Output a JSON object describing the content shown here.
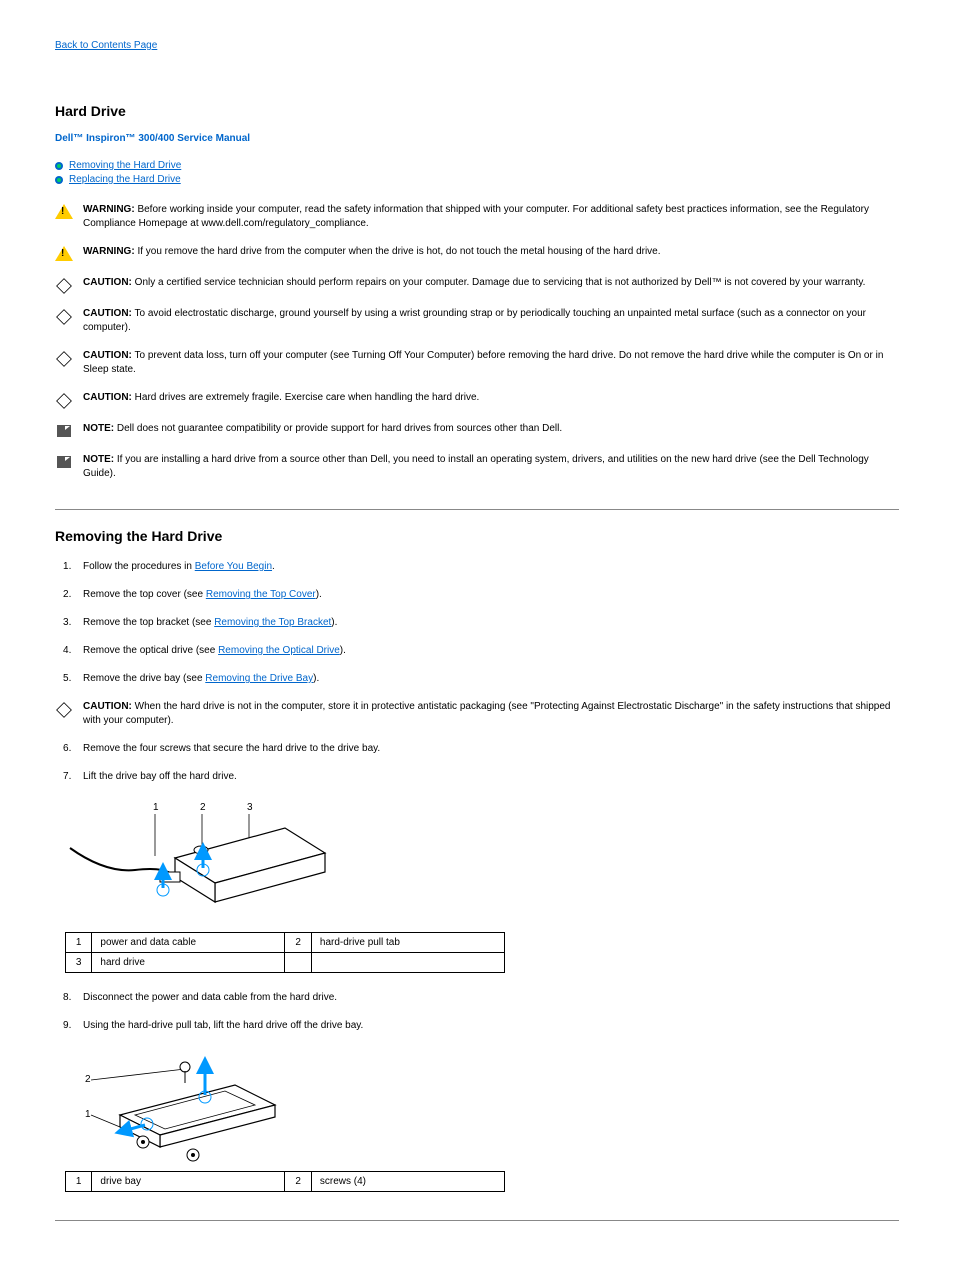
{
  "nav": {
    "back": "Back to Contents Page"
  },
  "title": "Hard Drive",
  "subtitle": "Dell™ Inspiron™ 300/400 Service Manual",
  "toc": [
    {
      "label": "Removing the Hard Drive"
    },
    {
      "label": "Replacing the Hard Drive"
    }
  ],
  "notices": [
    {
      "type": "warn",
      "lead": "WARNING:",
      "body": " Before working inside your computer, read the safety information that shipped with your computer. For additional safety best practices information, see the Regulatory Compliance Homepage at www.dell.com/regulatory_compliance."
    },
    {
      "type": "warn",
      "lead": "WARNING:",
      "body": " If you remove the hard drive from the computer when the drive is hot, do not touch the metal housing of the hard drive."
    },
    {
      "type": "caution",
      "lead": "CAUTION:",
      "body": " Only a certified service technician should perform repairs on your computer. Damage due to servicing that is not authorized by Dell™ is not covered by your warranty."
    },
    {
      "type": "caution",
      "lead": "CAUTION:",
      "body": " To avoid electrostatic discharge, ground yourself by using a wrist grounding strap or by periodically touching an unpainted metal surface (such as a connector on your computer)."
    },
    {
      "type": "caution",
      "lead": "CAUTION:",
      "body": " To prevent data loss, turn off your computer (see Turning Off Your Computer) before removing the hard drive. Do not remove the hard drive while the computer is On or in Sleep state."
    },
    {
      "type": "caution",
      "lead": "CAUTION:",
      "body": " Hard drives are extremely fragile. Exercise care when handling the hard drive."
    },
    {
      "type": "note",
      "lead": "NOTE:",
      "body": " Dell does not guarantee compatibility or provide support for hard drives from sources other than Dell."
    },
    {
      "type": "note",
      "lead": "NOTE:",
      "body": " If you are installing a hard drive from a source other than Dell, you need to install an operating system, drivers, and utilities on the new hard drive (see the Dell Technology Guide)."
    }
  ],
  "section1": {
    "title": "Removing the Hard Drive",
    "steps": [
      {
        "text": "Follow the procedures in ",
        "link": "Before You Begin",
        "rest": "."
      },
      {
        "text": "Remove the top cover (see ",
        "link": "Removing the Top Cover",
        "rest": ")."
      },
      {
        "text": "Remove the top bracket (see ",
        "link": "Removing the Top Bracket",
        "rest": ")."
      },
      {
        "text": "Remove the optical drive (see ",
        "link": "Removing the Optical Drive",
        "rest": ")."
      },
      {
        "text": "Remove the drive bay (see ",
        "link": "Removing the Drive Bay",
        "rest": ")."
      }
    ],
    "caution": {
      "lead": "CAUTION:",
      "body": " When the hard drive is not in the computer, store it in protective antistatic packaging (see \"Protecting Against Electrostatic Discharge\" in the safety instructions that shipped with your computer)."
    },
    "steps2": [
      {
        "text": "Remove the four screws that secure the hard drive to the drive bay."
      },
      {
        "text": "Lift the drive bay off the hard drive."
      }
    ],
    "table1": [
      {
        "n": "1",
        "d": "power and data cable"
      },
      {
        "n": "2",
        "d": "hard-drive pull tab"
      },
      {
        "n": "3",
        "d": "hard drive"
      }
    ],
    "steps3": [
      {
        "text": "Disconnect the power and data cable from the hard drive."
      },
      {
        "text": "Using the hard-drive pull tab, lift the hard drive off the drive bay."
      }
    ],
    "table2": [
      {
        "n": "1",
        "d": "drive bay"
      },
      {
        "n": "2",
        "d": "screws (4)"
      }
    ]
  }
}
